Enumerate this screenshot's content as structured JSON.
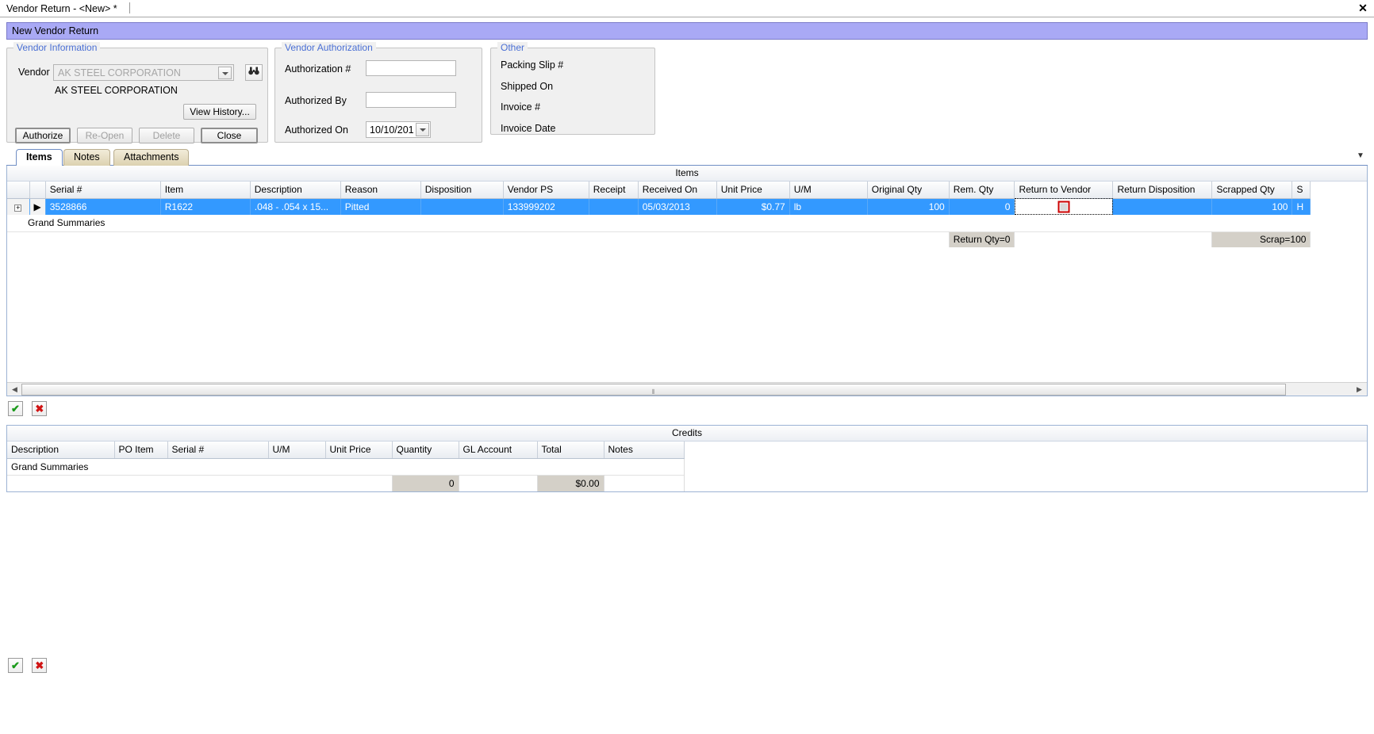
{
  "window": {
    "tab_title": "Vendor Return - <New> *",
    "close_label": "✕"
  },
  "banner": {
    "text": "New Vendor Return"
  },
  "vendor_information": {
    "group_title": "Vendor Information",
    "vendor_label": "Vendor",
    "vendor_value": "AK STEEL CORPORATION",
    "vendor_name_text": "AK STEEL CORPORATION",
    "lookup_icon": "binoculars-icon",
    "dropdown_icon": "chevron-down-icon",
    "view_history_label": "View History...",
    "authorize_label": "Authorize",
    "reopen_label": "Re-Open",
    "delete_label": "Delete",
    "close_label": "Close"
  },
  "vendor_authorization": {
    "group_title": "Vendor Authorization",
    "authorization_number_label": "Authorization #",
    "authorization_number_value": "",
    "authorized_by_label": "Authorized By",
    "authorized_by_value": "",
    "authorized_on_label": "Authorized On",
    "authorized_on_value": "10/10/201"
  },
  "other": {
    "group_title": "Other",
    "packing_slip_label": "Packing Slip #",
    "shipped_on_label": "Shipped On",
    "invoice_number_label": "Invoice #",
    "invoice_date_label": "Invoice Date"
  },
  "tabs": [
    {
      "label": "Items",
      "active": true
    },
    {
      "label": "Notes",
      "active": false
    },
    {
      "label": "Attachments",
      "active": false
    }
  ],
  "items_grid": {
    "caption": "Items",
    "columns": [
      "Serial #",
      "Item",
      "Description",
      "Reason",
      "Disposition",
      "Vendor PS",
      "Receipt",
      "Received On",
      "Unit Price",
      "U/M",
      "Original Qty",
      "Rem. Qty",
      "Return to Vendor",
      "Return Disposition",
      "Scrapped Qty",
      "S"
    ],
    "rows": [
      {
        "serial": "3528866",
        "item": "R1622",
        "description": ".048 - .054  x 15...",
        "reason": "Pitted",
        "disposition": "",
        "vendor_ps": "133999202",
        "receipt": "",
        "received_on": "05/03/2013",
        "unit_price": "$0.77",
        "um": "lb",
        "original_qty": "100",
        "rem_qty": "0",
        "return_to_vendor": "",
        "return_disposition": "",
        "scrapped_qty": "100",
        "s": "H",
        "selected": true,
        "editing_cell": "return_to_vendor"
      }
    ],
    "grand_summaries_label": "Grand Summaries",
    "summary_return_qty": "Return Qty=0",
    "summary_scrap": "Scrap=100",
    "add_icon": "check-icon",
    "delete_icon": "cross-icon",
    "add_label": "✔",
    "delete_label": "✖",
    "scroll_left_icon": "◀",
    "scroll_right_icon": "▶",
    "scroll_grip": "⦀"
  },
  "credits_grid": {
    "caption": "Credits",
    "columns": [
      "Description",
      "PO Item",
      "Serial #",
      "U/M",
      "Unit Price",
      "Quantity",
      "GL Account",
      "Total",
      "Notes"
    ],
    "grand_summaries_label": "Grand Summaries",
    "summary_quantity": "0",
    "summary_total": "$0.00",
    "add_label": "✔",
    "delete_label": "✖"
  },
  "colors": {
    "banner_bg": "#a9a9f5",
    "selection_blue": "#3399ff",
    "group_title": "#4a6fd4",
    "editor_red": "#cc0000"
  }
}
